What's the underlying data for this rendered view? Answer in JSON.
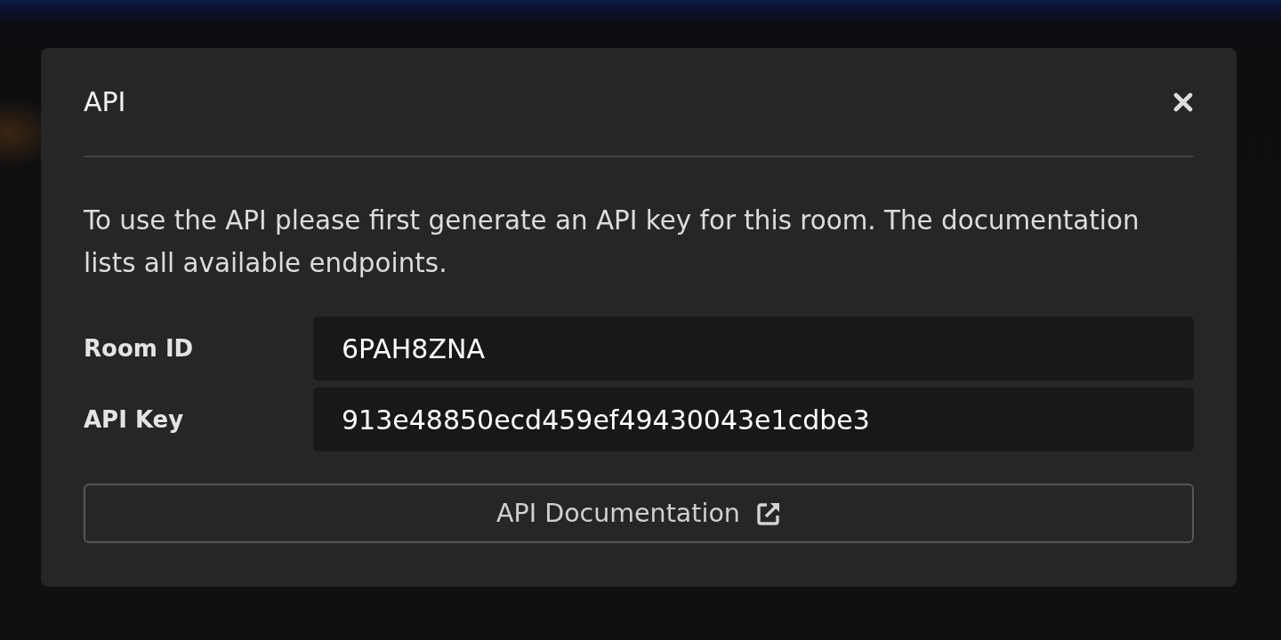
{
  "dialog": {
    "title": "API",
    "description": "To use the API please first generate an API key for this room. The documentation lists all available endpoints.",
    "fields": [
      {
        "label": "Room ID",
        "value": "6PAH8ZNA"
      },
      {
        "label": "API Key",
        "value": "913e48850ecd459ef49430043e1cdbe3"
      }
    ],
    "documentation_button": {
      "label": "API Documentation"
    }
  }
}
